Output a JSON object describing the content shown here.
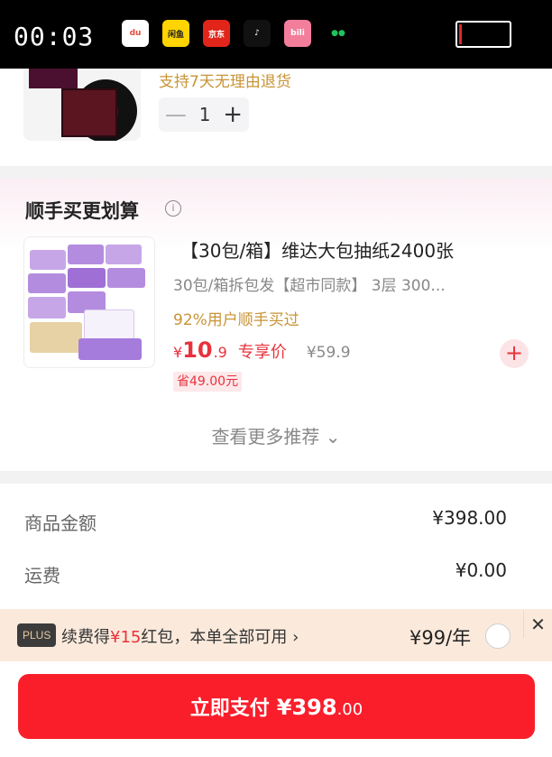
{
  "status_bar": {
    "time": "00:03",
    "apps": [
      {
        "name": "得物",
        "icon": "dewu-app-icon",
        "label": "du",
        "bg": "#ffffff",
        "fg": "#e94b3c"
      },
      {
        "name": "闲鱼",
        "icon": "xianyu-app-icon",
        "label": "闲鱼",
        "bg": "#ffd400",
        "fg": "#222222"
      },
      {
        "name": "京东",
        "icon": "jd-app-icon",
        "label": "京东",
        "bg": "#e1251b",
        "fg": "#ffffff"
      },
      {
        "name": "抖音",
        "icon": "douyin-app-icon",
        "label": "♪",
        "bg": "#111111",
        "fg": "#ffffff"
      },
      {
        "name": "哔哩哔哩",
        "icon": "bilibili-app-icon",
        "label": "bili",
        "bg": "#f37e9b",
        "fg": "#ffffff"
      },
      {
        "name": "微信",
        "icon": "wechat-app-icon",
        "label": "●●",
        "bg": "#000000",
        "fg": "#21c35b"
      }
    ]
  },
  "product": {
    "return_policy": "支持7天无理由退货",
    "quantity": "1",
    "minus": "—",
    "plus": "+"
  },
  "recommend": {
    "title": "顺手买更划算",
    "info": "i",
    "item": {
      "name": "【30包/箱】维达大包抽纸2400张",
      "spec": "30包/箱拆包发【超市同款】 3层 300...",
      "social": "92%用户顺手买过",
      "price_yen": "¥",
      "price_int": "10",
      "price_dec": ".9",
      "price_tag": "专享价",
      "original_price": "¥59.9",
      "save": "省49.00元",
      "add": "+"
    },
    "more": "查看更多推荐 ⌄"
  },
  "summary": {
    "goods_label": "商品金额",
    "goods_value": "¥398.00",
    "shipping_label": "运费",
    "shipping_value": "¥0.00"
  },
  "plus_bar": {
    "badge": "PLUS",
    "text_prefix": "续费得",
    "text_amount": "¥15",
    "text_suffix": "红包，本单全部可用",
    "arrow": "›",
    "price": "¥99/年",
    "close": "✕"
  },
  "pay": {
    "label": "立即支付",
    "amount": "¥398",
    "decimal": ".00"
  }
}
